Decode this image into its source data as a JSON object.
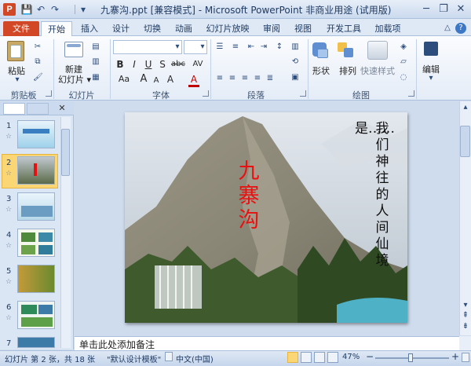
{
  "window": {
    "title": "九寨沟.ppt [兼容模式] - Microsoft PowerPoint 非商业用途 (试用版)",
    "logo": "P",
    "controls": {
      "minimize": "─",
      "restore": "❐",
      "close": "✕"
    }
  },
  "qat": {
    "save": "💾",
    "undo": "↶",
    "redo": "↷",
    "customize": "▾"
  },
  "ribbon": {
    "file_tab": "文件",
    "tabs": [
      "开始",
      "插入",
      "设计",
      "切换",
      "动画",
      "幻灯片放映",
      "审阅",
      "视图",
      "开发工具",
      "加载项"
    ],
    "help": "?",
    "minimize": "△",
    "clipboard": {
      "paste_label": "粘贴",
      "group_label": "剪贴板"
    },
    "slides": {
      "new_slide_label": "新建",
      "new_slide_label2": "幻灯片 ▾",
      "group_label": "幻灯片"
    },
    "font": {
      "group_label": "字体",
      "font_name_value": "",
      "font_size_value": "",
      "bold": "B",
      "italic": "I",
      "underline": "U",
      "shadow": "S",
      "strike": "abc",
      "spacing": "AV",
      "case": "Aa",
      "grow": "A",
      "shrink": "A",
      "clear": "A",
      "color": "A"
    },
    "paragraph": {
      "group_label": "段落"
    },
    "drawing": {
      "shape_label": "形状",
      "arrange_label": "排列",
      "quick_style_label": "快速样式",
      "group_label": "绘图"
    },
    "editing": {
      "edit_label": "编辑"
    }
  },
  "left_pane": {
    "close": "✕",
    "thumbnails": [
      {
        "num": "1",
        "star": "☆"
      },
      {
        "num": "2",
        "star": "☆"
      },
      {
        "num": "3",
        "star": "☆"
      },
      {
        "num": "4",
        "star": "☆"
      },
      {
        "num": "5",
        "star": "☆"
      },
      {
        "num": "6",
        "star": "☆"
      },
      {
        "num": "7",
        "star": ""
      }
    ]
  },
  "slide": {
    "title_vertical": "九寨沟",
    "poem_col1": "我们神往的人间仙境",
    "poem_col2": "是……"
  },
  "notes": {
    "placeholder": "单击此处添加备注"
  },
  "status": {
    "slide_info": "幻灯片 第 2 张，共 18 张",
    "theme": "\"默认设计模板\"",
    "language": "中文(中国)",
    "zoom": "47%",
    "zoom_minus": "−",
    "zoom_plus": "+"
  },
  "colors": {
    "accent": "#d24726",
    "title_red": "#e81010",
    "selection": "#fbd675"
  }
}
